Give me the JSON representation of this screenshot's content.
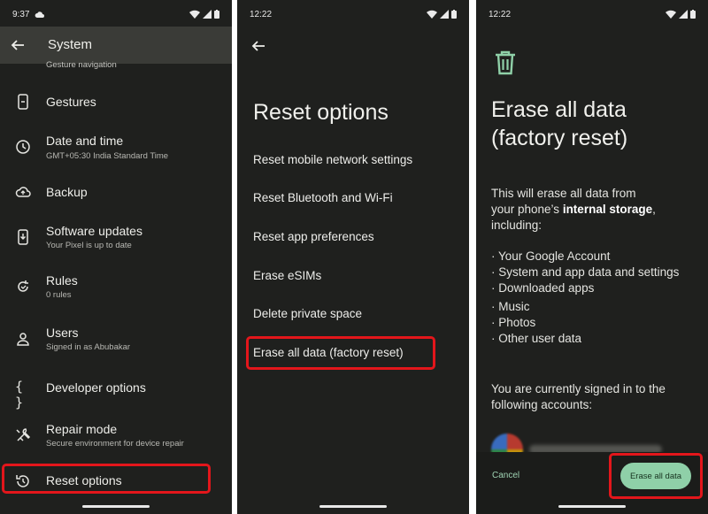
{
  "colors": {
    "highlight": "#e3161b",
    "accent": "#8fd0a8",
    "panel_bg": "#1f201e",
    "header_bg": "#3a3b37"
  },
  "panel1": {
    "status_time": "9:37",
    "title": "System",
    "cutoff_text": "Gesture navigation",
    "items": [
      {
        "icon": "phone-gesture-icon",
        "label": "Gestures",
        "sub": ""
      },
      {
        "icon": "clock-icon",
        "label": "Date and time",
        "sub": "GMT+05:30 India Standard Time"
      },
      {
        "icon": "cloud-upload-icon",
        "label": "Backup",
        "sub": ""
      },
      {
        "icon": "system-update-icon",
        "label": "Software updates",
        "sub": "Your Pixel is up to date"
      },
      {
        "icon": "rules-icon",
        "label": "Rules",
        "sub": "0 rules"
      },
      {
        "icon": "person-icon",
        "label": "Users",
        "sub": "Signed in as Abubakar"
      },
      {
        "icon": "braces-icon",
        "label": "Developer options",
        "sub": ""
      },
      {
        "icon": "tools-icon",
        "label": "Repair mode",
        "sub": "Secure environment for device repair"
      },
      {
        "icon": "history-icon",
        "label": "Reset options",
        "sub": ""
      }
    ]
  },
  "panel2": {
    "status_time": "12:22",
    "title": "Reset options",
    "options": [
      "Reset mobile network settings",
      "Reset Bluetooth and Wi-Fi",
      "Reset app preferences",
      "Erase eSIMs",
      "Delete private space",
      "Erase all data (factory reset)"
    ]
  },
  "panel3": {
    "status_time": "12:22",
    "title_line1": "Erase all data",
    "title_line2": "(factory reset)",
    "intro_1": "This will erase all data from",
    "intro_2_pre": "your phone’s ",
    "intro_2_bold": "internal storage",
    "intro_2_post": ",",
    "intro_3": "including:",
    "bullets": [
      "· Your Google Account",
      "· System and app data and settings",
      "· Downloaded apps",
      "· Music",
      "· Photos",
      "· Other user data"
    ],
    "signed_in_1": "You are currently signed in to the",
    "signed_in_2": "following accounts:",
    "cancel_label": "Cancel",
    "erase_label": "Erase all data"
  }
}
